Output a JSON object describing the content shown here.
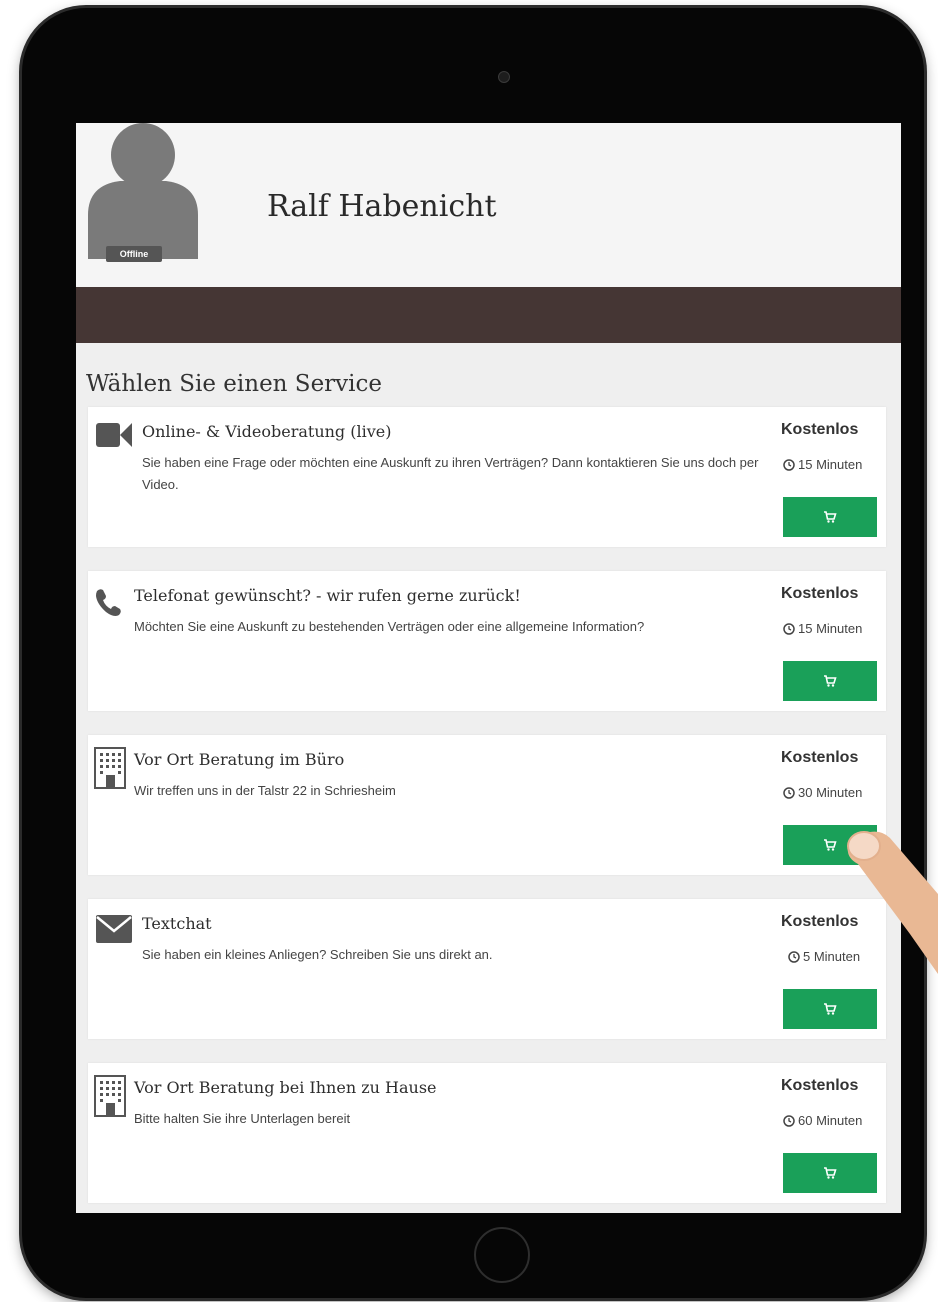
{
  "profile": {
    "name": "Ralf Habenicht",
    "status": "Offline"
  },
  "section_title": "Wählen Sie einen Service",
  "services": [
    {
      "icon": "video-camera-icon",
      "title": "Online- & Videoberatung (live)",
      "description": "Sie haben eine Frage oder möchten eine Auskunft zu ihren Verträgen? Dann kontaktieren Sie uns doch per Video.",
      "price": "Kostenlos",
      "duration": "15 Minuten"
    },
    {
      "icon": "phone-icon",
      "title": "Telefonat gewünscht? - wir rufen gerne zurück!",
      "description": "Möchten Sie eine Auskunft zu bestehenden Verträgen oder eine allgemeine Information?",
      "price": "Kostenlos",
      "duration": "15 Minuten"
    },
    {
      "icon": "office-building-icon",
      "title": "Vor Ort Beratung im Büro",
      "description": "Wir treffen uns in der Talstr 22 in Schriesheim",
      "price": "Kostenlos",
      "duration": "30 Minuten"
    },
    {
      "icon": "envelope-icon",
      "title": "Textchat",
      "description": "Sie haben ein kleines Anliegen? Schreiben Sie uns direkt an.",
      "price": "Kostenlos",
      "duration": "5 Minuten"
    },
    {
      "icon": "office-building-icon",
      "title": "Vor Ort Beratung bei Ihnen zu Hause",
      "description": "Bitte halten Sie ihre Unterlagen bereit",
      "price": "Kostenlos",
      "duration": "60 Minuten"
    }
  ],
  "colors": {
    "header_bar": "#453634",
    "cart_button": "#1aa059",
    "screen_background": "#efefef"
  }
}
